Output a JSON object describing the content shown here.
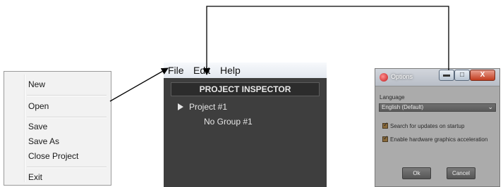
{
  "file_menu": {
    "items": [
      "New",
      "Open",
      "Save",
      "Save As",
      "Close Project",
      "Exit"
    ]
  },
  "menubar": {
    "items": [
      "File",
      "Edit",
      "Help"
    ]
  },
  "inspector": {
    "header": "PROJECT INSPECTOR",
    "project": "Project #1",
    "group": "No Group #1"
  },
  "options_dialog": {
    "title": "Options",
    "language_label": "Language",
    "language_value": "English (Default)",
    "check_updates_label": "Search for updates on startup",
    "hw_accel_label": "Enable hardware graphics acceleration",
    "check_updates_checked": true,
    "hw_accel_checked": true,
    "ok_label": "Ok",
    "cancel_label": "Cancel",
    "minimize_glyph": "▬",
    "maximize_glyph": "□",
    "close_glyph": "X"
  },
  "icons": {
    "tree_expand": "play-triangle-icon",
    "check": "checkmark-icon",
    "dropdown": "chevron-down-icon",
    "app": "options-app-icon"
  },
  "colors": {
    "inspector_bg": "#3e3e3e",
    "dialog_bg": "#ababab",
    "close_button": "#c23c1f"
  }
}
